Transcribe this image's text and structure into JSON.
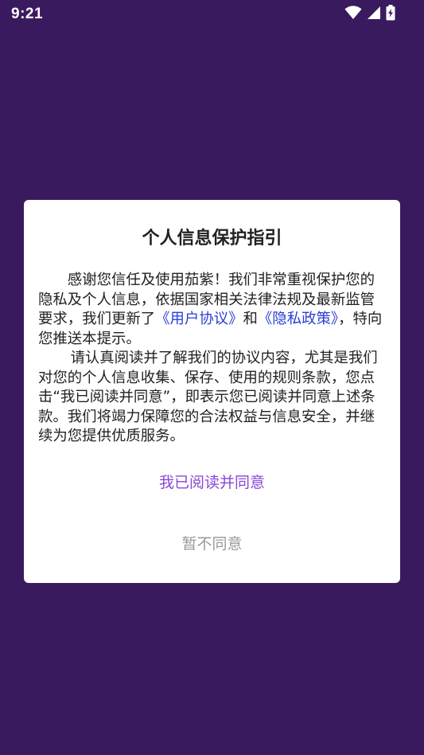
{
  "status_bar": {
    "time": "9:21",
    "icons": [
      "wifi-icon",
      "cellular-signal-icon",
      "battery-charging-icon"
    ]
  },
  "dialog": {
    "title": "个人信息保护指引",
    "paragraph1": {
      "text_before": "感谢您信任及使用茄紫！我们非常重视保护您的隐私及个人信息，依据国家相关法律法规及最新监管要求，我们更新了",
      "user_agreement_link": "《用户协议》",
      "conjunction": "和",
      "privacy_policy_link": "《隐私政策》",
      "text_after": "，特向您推送本提示。"
    },
    "paragraph2": "请认真阅读并了解我们的协议内容，尤其是我们对您的个人信息收集、保存、使用的规则条款，您点击“我已阅读并同意”，即表示您已阅读并同意上述条款。我们将竭力保障您的合法权益与信息安全，并继续为您提供优质服务。",
    "agree_label": "我已阅读并同意",
    "decline_label": "暂不同意"
  },
  "colors": {
    "background": "#3a1a5e",
    "link": "#2a3fd4",
    "agree": "#8847d6",
    "decline": "#999999"
  }
}
